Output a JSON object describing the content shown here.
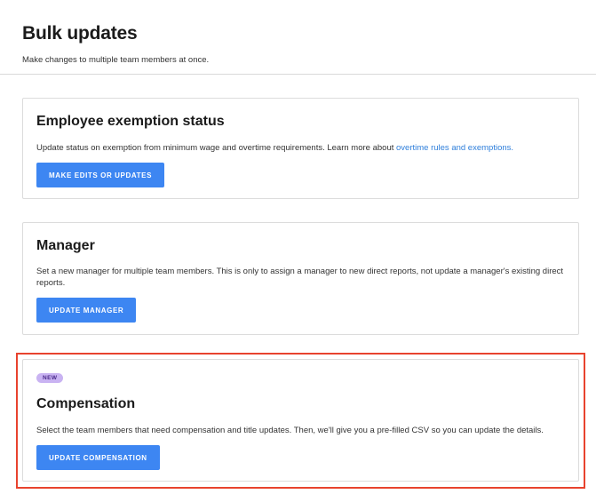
{
  "header": {
    "title": "Bulk updates",
    "subtitle": "Make changes to multiple team members at once."
  },
  "cards": {
    "exemption": {
      "title": "Employee exemption status",
      "description": "Update status on exemption from minimum wage and overtime requirements. Learn more about ",
      "link_text": "overtime rules and exemptions.",
      "button_label": "MAKE EDITS OR UPDATES"
    },
    "manager": {
      "title": "Manager",
      "description": "Set a new manager for multiple team members. This is only to assign a manager to new direct reports, not update a manager's existing direct reports.",
      "button_label": "UPDATE MANAGER"
    },
    "compensation": {
      "badge": "NEW",
      "title": "Compensation",
      "description": "Select the team members that need compensation and title updates. Then, we'll give you a pre-filled CSV so you can update the details.",
      "button_label": "UPDATE COMPENSATION"
    }
  },
  "colors": {
    "accent_button": "#3d86f2",
    "link": "#2f7fdb",
    "highlight_border": "#e8432e",
    "badge_bg": "#c9b3f2"
  }
}
